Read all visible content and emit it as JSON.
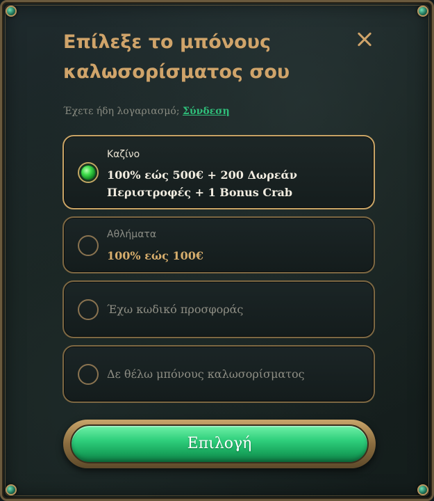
{
  "dialog": {
    "title": "Επίλεξε το μπόνους καλωσορίσματος σου",
    "account_prompt": "Έχετε ήδη λογαριασμό;",
    "login_link": "Σύνδεση"
  },
  "options": [
    {
      "label": "Καζίνο",
      "value": "100% εώς 500€ + 200 Δωρεάν Περιστροφές + 1 Bonus Crab",
      "selected": true
    },
    {
      "label": "Αθλήματα",
      "value": "100% εώς 100€",
      "selected": false
    },
    {
      "text": "Έχω κωδικό προσφοράς",
      "selected": false
    },
    {
      "text": "Δε θέλω μπόνους καλωσορίσματος",
      "selected": false
    }
  ],
  "cta": {
    "label": "Επιλογή"
  },
  "colors": {
    "accent_gold": "#d0a46a",
    "cta_green": "#2fcf7c",
    "link_green": "#2fbf7a"
  }
}
